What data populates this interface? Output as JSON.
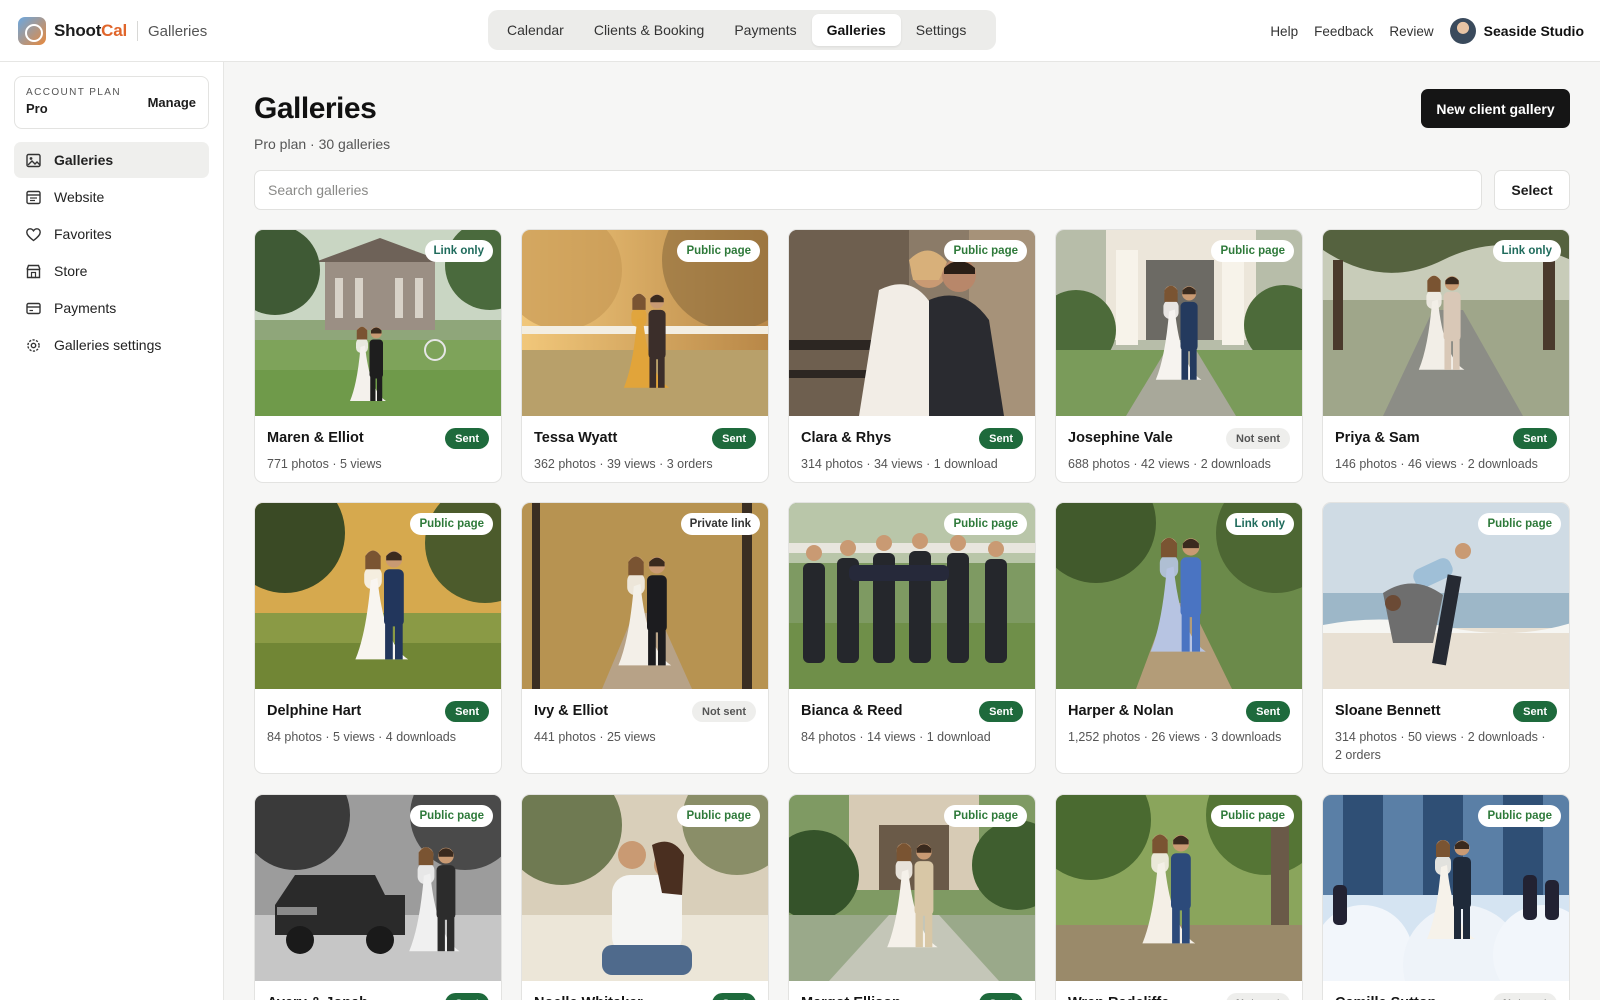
{
  "app": {
    "name_part1": "Shoot",
    "name_part2": "Cal",
    "section": "Galleries"
  },
  "nav": {
    "tabs": [
      {
        "label": "Calendar",
        "active": false
      },
      {
        "label": "Clients & Booking",
        "active": false
      },
      {
        "label": "Payments",
        "active": false
      },
      {
        "label": "Galleries",
        "active": true
      },
      {
        "label": "Settings",
        "active": false
      }
    ],
    "links": [
      "Help",
      "Feedback",
      "Review"
    ],
    "studio": "Seaside Studio"
  },
  "sidebar": {
    "plan_label": "ACCOUNT PLAN",
    "plan_name": "Pro",
    "manage_label": "Manage",
    "items": [
      {
        "label": "Galleries",
        "icon": "gallery-icon",
        "active": true
      },
      {
        "label": "Website",
        "icon": "website-icon",
        "active": false
      },
      {
        "label": "Favorites",
        "icon": "heart-icon",
        "active": false
      },
      {
        "label": "Store",
        "icon": "store-icon",
        "active": false
      },
      {
        "label": "Payments",
        "icon": "card-icon",
        "active": false
      },
      {
        "label": "Galleries settings",
        "icon": "gear-icon",
        "active": false
      }
    ]
  },
  "main": {
    "title": "Galleries",
    "subtitle": "Pro plan · 30 galleries",
    "new_button": "New client gallery",
    "search_placeholder": "Search galleries",
    "select_label": "Select"
  },
  "colors": {
    "sent_bg": "#1e6a3c",
    "notsent_bg": "#eeeeec",
    "link_text": "#1f6b5c",
    "public_text": "#2e7a3a",
    "private_text": "#333333"
  },
  "galleries": [
    {
      "name": "Maren & Elliot",
      "meta": "771 photos · 5 views",
      "visibility": "Link only",
      "status": "Sent",
      "scene": "estate"
    },
    {
      "name": "Tessa Wyatt",
      "meta": "362 photos · 39 views · 3 orders",
      "visibility": "Public page",
      "status": "Sent",
      "scene": "golden"
    },
    {
      "name": "Clara & Rhys",
      "meta": "314 photos · 34 views · 1 download",
      "visibility": "Public page",
      "status": "Sent",
      "scene": "bridge"
    },
    {
      "name": "Josephine Vale",
      "meta": "688 photos · 42 views · 2 downloads",
      "visibility": "Public page",
      "status": "Not sent",
      "scene": "portico"
    },
    {
      "name": "Priya & Sam",
      "meta": "146 photos · 46 views · 2 downloads",
      "visibility": "Link only",
      "status": "Sent",
      "scene": "oaks"
    },
    {
      "name": "Delphine Hart",
      "meta": "84 photos · 5 views · 4 downloads",
      "visibility": "Public page",
      "status": "Sent",
      "scene": "meadow"
    },
    {
      "name": "Ivy & Elliot",
      "meta": "441 photos · 25 views",
      "visibility": "Private link",
      "status": "Not sent",
      "scene": "amber"
    },
    {
      "name": "Bianca & Reed",
      "meta": "84 photos · 14 views · 1 download",
      "visibility": "Public page",
      "status": "Sent",
      "scene": "groomsmen"
    },
    {
      "name": "Harper & Nolan",
      "meta": "1,252 photos · 26 views · 3 downloads",
      "visibility": "Link only",
      "status": "Sent",
      "scene": "path"
    },
    {
      "name": "Sloane Bennett",
      "meta": "314 photos · 50 views · 2 downloads · 2 orders",
      "visibility": "Public page",
      "status": "Sent",
      "scene": "beach"
    },
    {
      "name": "Avery & Jonah",
      "meta": "",
      "visibility": "Public page",
      "status": "Sent",
      "scene": "truck"
    },
    {
      "name": "Noelle Whitaker",
      "meta": "",
      "visibility": "Public page",
      "status": "Sent",
      "scene": "sand"
    },
    {
      "name": "Margot Ellison",
      "meta": "",
      "visibility": "Public page",
      "status": "Sent",
      "scene": "courtyard"
    },
    {
      "name": "Wren Radcliffe",
      "meta": "",
      "visibility": "Public page",
      "status": "Not sent",
      "scene": "park"
    },
    {
      "name": "Camille Sutton",
      "meta": "",
      "visibility": "Public page",
      "status": "Not sent",
      "scene": "dance"
    }
  ]
}
